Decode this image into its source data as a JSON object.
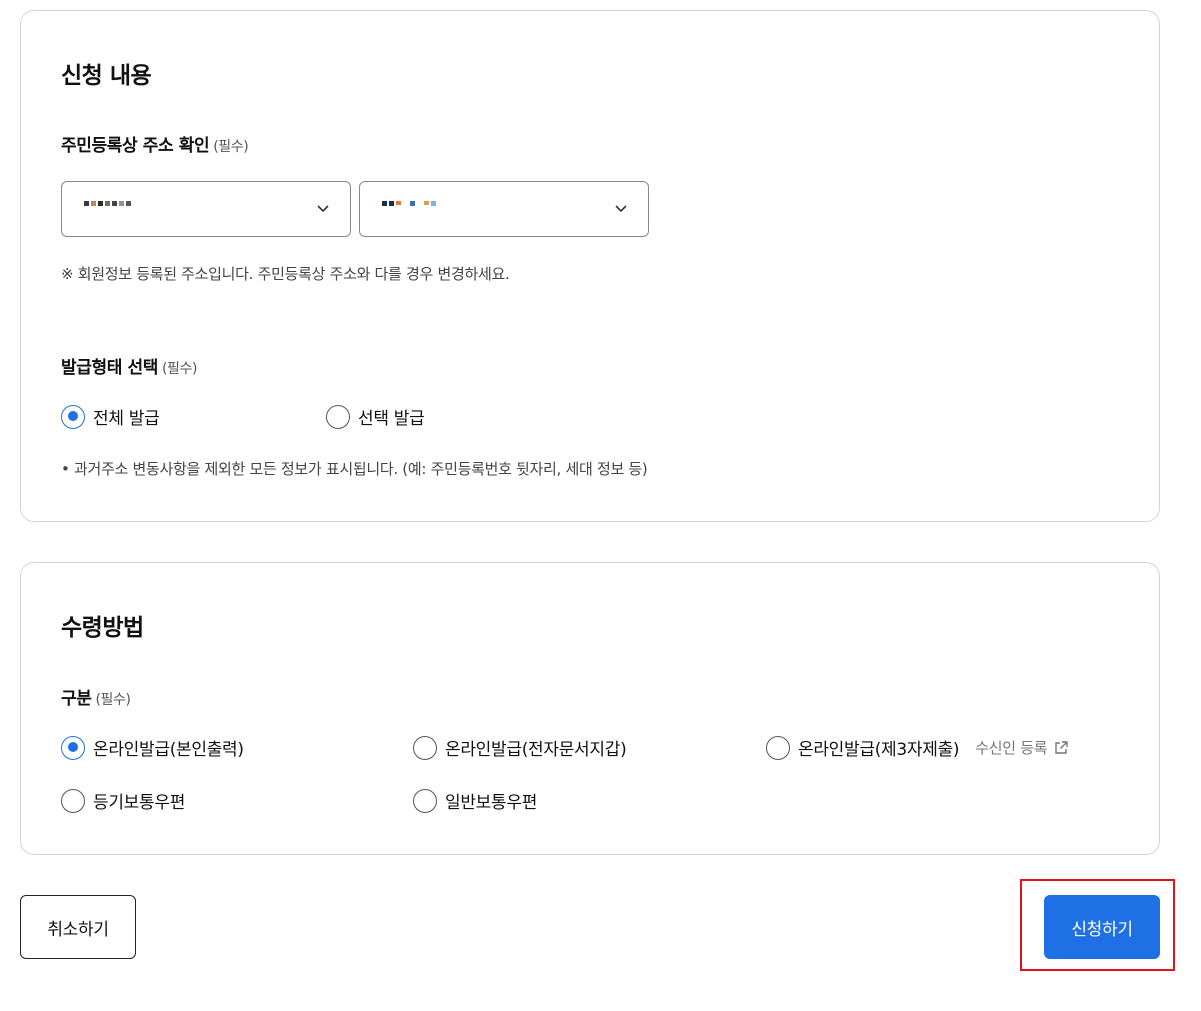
{
  "apply": {
    "title": "신청 내용",
    "address": {
      "label": "주민등록상 주소 확인",
      "required": "(필수)",
      "note": "※ 회원정보 등록된 주소입니다. 주민등록상 주소와 다를 경우 변경하세요."
    },
    "issue_type": {
      "label": "발급형태 선택",
      "required": "(필수)",
      "options": [
        "전체 발급",
        "선택 발급"
      ],
      "selected": 0,
      "note": "• 과거주소 변동사항을 제외한 모든 정보가 표시됩니다. (예: 주민등록번호 뒷자리, 세대 정보 등)"
    }
  },
  "receive": {
    "title": "수령방법",
    "category": {
      "label": "구분",
      "required": "(필수)",
      "options": [
        "온라인발급(본인출력)",
        "온라인발급(전자문서지갑)",
        "온라인발급(제3자제출)",
        "등기보통우편",
        "일반보통우편"
      ],
      "selected": 0,
      "recipient_link": "수신인 등록"
    }
  },
  "buttons": {
    "cancel": "취소하기",
    "submit": "신청하기"
  },
  "colors": {
    "accent": "#1f6fe5",
    "highlight": "#e3121b",
    "border": "#d4d4d4"
  },
  "icons": {
    "dropdown": "chevron-down-icon",
    "external": "external-link-icon"
  }
}
